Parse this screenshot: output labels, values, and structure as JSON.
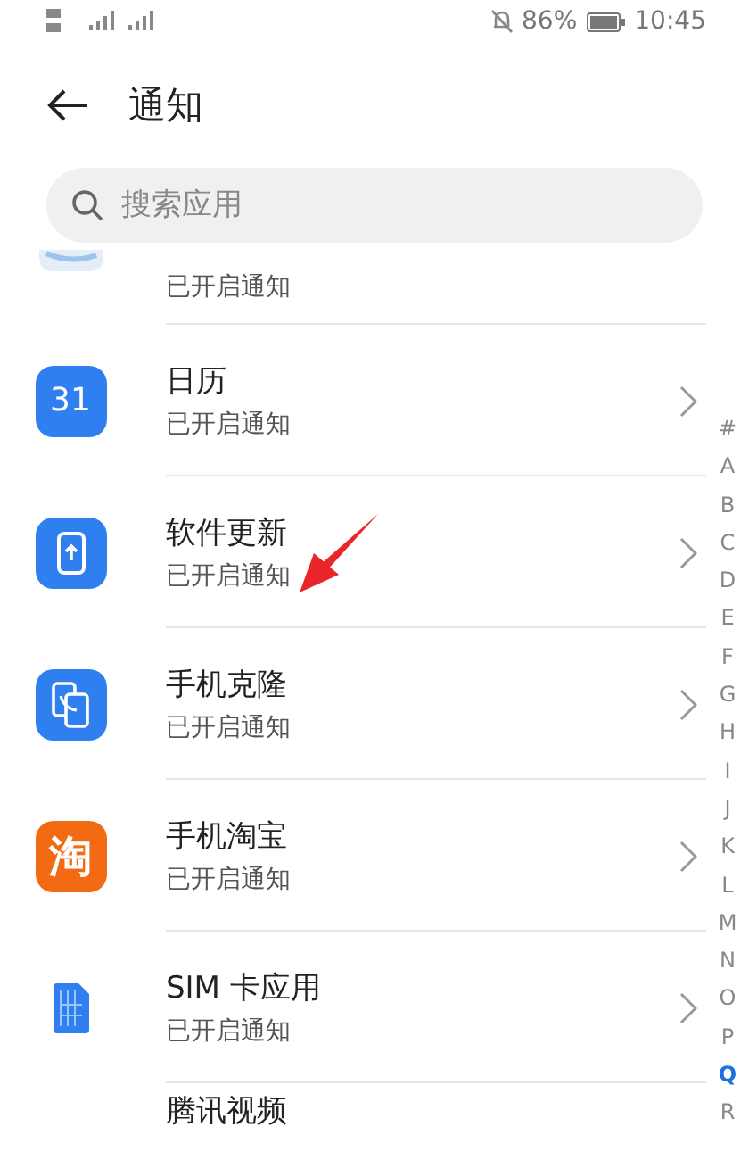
{
  "status_bar": {
    "battery": "86%",
    "time": "10:45"
  },
  "header": {
    "title": "通知"
  },
  "search": {
    "placeholder": "搜索应用"
  },
  "apps": [
    {
      "kind": "partial",
      "subtitle": "已开启通知"
    },
    {
      "kind": "calendar",
      "icon_text": "31",
      "name": "日历",
      "subtitle": "已开启通知"
    },
    {
      "kind": "update",
      "name": "软件更新",
      "subtitle": "已开启通知"
    },
    {
      "kind": "clone",
      "name": "手机克隆",
      "subtitle": "已开启通知"
    },
    {
      "kind": "taobao",
      "icon_text": "淘",
      "name": "手机淘宝",
      "subtitle": "已开启通知"
    },
    {
      "kind": "sim",
      "name": "SIM 卡应用",
      "subtitle": "已开启通知"
    },
    {
      "kind": "cut",
      "name": "腾讯视频"
    }
  ],
  "index": [
    {
      "label": "#",
      "selected": false
    },
    {
      "label": "A",
      "selected": false
    },
    {
      "label": "B",
      "selected": false
    },
    {
      "label": "C",
      "selected": false
    },
    {
      "label": "D",
      "selected": false
    },
    {
      "label": "E",
      "selected": false
    },
    {
      "label": "F",
      "selected": false
    },
    {
      "label": "G",
      "selected": false
    },
    {
      "label": "H",
      "selected": false
    },
    {
      "label": "I",
      "selected": false
    },
    {
      "label": "J",
      "selected": false
    },
    {
      "label": "K",
      "selected": false
    },
    {
      "label": "L",
      "selected": false
    },
    {
      "label": "M",
      "selected": false
    },
    {
      "label": "N",
      "selected": false
    },
    {
      "label": "O",
      "selected": false
    },
    {
      "label": "P",
      "selected": false
    },
    {
      "label": "Q",
      "selected": true
    },
    {
      "label": "R",
      "selected": false
    }
  ]
}
